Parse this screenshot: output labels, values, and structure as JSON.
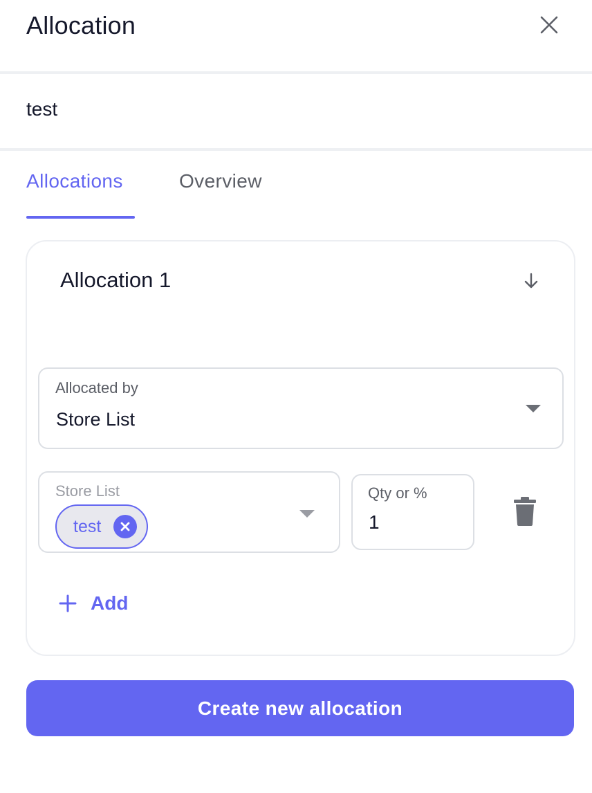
{
  "header": {
    "title": "Allocation",
    "close_icon": "close-icon"
  },
  "allocation_name": "test",
  "tabs": [
    {
      "label": "Allocations",
      "active": true
    },
    {
      "label": "Overview",
      "active": false
    }
  ],
  "card": {
    "title": "Allocation 1",
    "expand_icon": "arrow-down-icon",
    "allocated_by": {
      "label": "Allocated by",
      "value": "Store List"
    },
    "store_list": {
      "label": "Store List",
      "chips": [
        "test"
      ]
    },
    "qty": {
      "label": "Qty or %",
      "value": "1"
    },
    "delete_icon": "trash-icon",
    "add_label": "Add"
  },
  "primary_button": "Create new allocation",
  "colors": {
    "accent": "#6366f1",
    "text": "#15182b",
    "muted": "#5b5e66",
    "border": "#dcdfe4"
  }
}
